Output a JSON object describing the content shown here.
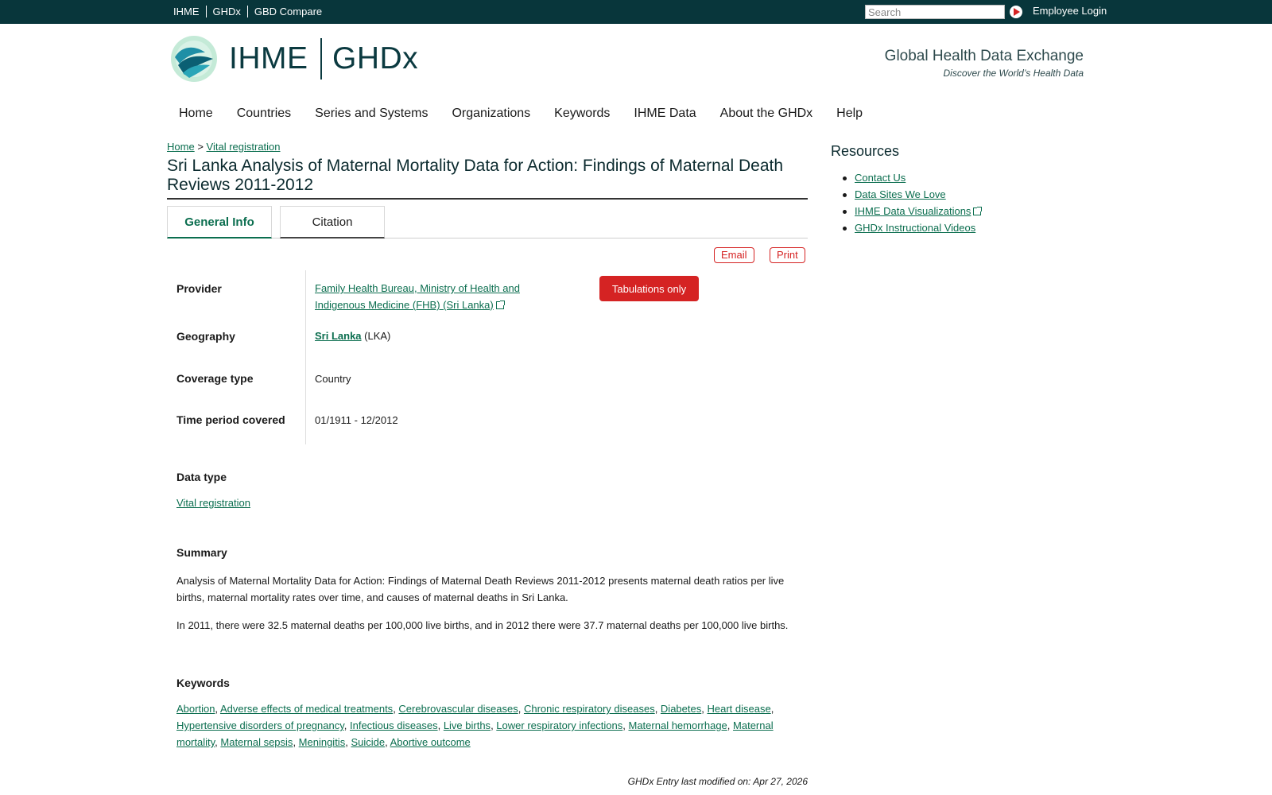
{
  "topbar": {
    "links": [
      "IHME",
      "GHDx",
      "GBD Compare"
    ],
    "search_placeholder": "Search",
    "login_label": "Employee Login"
  },
  "header": {
    "brand_left": "IHME",
    "brand_right": "GHDx",
    "tagline": "Global Health Data Exchange",
    "subtagline": "Discover the World’s Health Data"
  },
  "nav": {
    "items": [
      "Home",
      "Countries",
      "Series and Systems",
      "Organizations",
      "Keywords",
      "IHME Data",
      "About the GHDx",
      "Help"
    ]
  },
  "breadcrumb": {
    "home": "Home",
    "sep": ">",
    "current": "Vital registration"
  },
  "page": {
    "title": "Sri Lanka Analysis of Maternal Mortality Data for Action: Findings of Maternal Death Reviews 2011-2012"
  },
  "tabs": {
    "general": "General Info",
    "citation": "Citation"
  },
  "actions": {
    "email": "Email",
    "print": "Print"
  },
  "info": {
    "provider_label": "Provider",
    "provider_value": "Family Health Bureau, Ministry of Health and Indigenous Medicine (FHB) (Sri Lanka)",
    "tabulations_badge": "Tabulations only",
    "geography_label": "Geography",
    "geography_link": "Sri Lanka",
    "geography_code": "(LKA)",
    "coverage_label": "Coverage type",
    "coverage_value": "Country",
    "time_label": "Time period covered",
    "time_value": "01/1911 - 12/2012"
  },
  "data_type": {
    "heading": "Data type",
    "value": "Vital registration"
  },
  "summary": {
    "heading": "Summary",
    "p1": "Analysis of Maternal Mortality Data for Action: Findings of Maternal Death Reviews 2011-2012 presents maternal death ratios per live births, maternal mortality rates over time, and causes of maternal deaths in Sri Lanka.",
    "p2": "In 2011, there were 32.5 maternal deaths per 100,000 live births, and in 2012 there were 37.7 maternal deaths per 100,000 live births."
  },
  "keywords": {
    "heading": "Keywords",
    "items": [
      "Abortion",
      "Adverse effects of medical treatments",
      "Cerebrovascular diseases",
      "Chronic respiratory diseases",
      "Diabetes",
      "Heart disease",
      "Hypertensive disorders of pregnancy",
      "Infectious diseases",
      "Live births",
      "Lower respiratory infections",
      "Maternal hemorrhage",
      "Maternal mortality",
      "Maternal sepsis",
      "Meningitis",
      "Suicide",
      "Abortive outcome"
    ]
  },
  "footer": {
    "modified": "GHDx Entry last modified on: Apr 27, 2026"
  },
  "resources": {
    "title": "Resources",
    "items": [
      "Contact Us",
      "Data Sites We Love",
      "IHME Data Visualizations",
      "GHDx Instructional Videos"
    ]
  },
  "colors": {
    "topbar": "#08363b",
    "link": "#0b6e4f",
    "accent_red": "#d52323",
    "brand_dark": "#0b3a40"
  }
}
